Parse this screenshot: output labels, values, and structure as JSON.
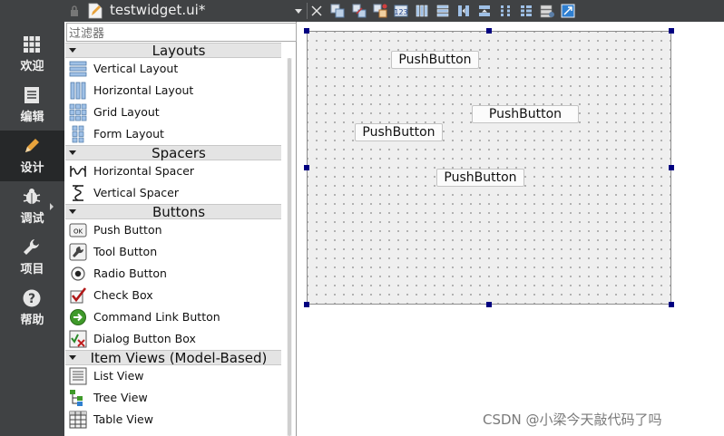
{
  "toolbar": {
    "document_title": "testwidget.ui*",
    "buttons": [
      "edit-widgets-icon",
      "edit-signals-icon",
      "edit-buddies-icon",
      "edit-tab-order-icon",
      "layout-horizontal-icon",
      "layout-vertical-icon",
      "layout-horizontal-splitter-icon",
      "layout-vertical-splitter-icon",
      "layout-grid-icon",
      "layout-form-icon",
      "break-layout-icon",
      "adjust-size-icon"
    ]
  },
  "modes": [
    {
      "label": "欢迎",
      "icon": "grid-icon"
    },
    {
      "label": "编辑",
      "icon": "document-icon"
    },
    {
      "label": "设计",
      "icon": "pencil-icon",
      "active": true
    },
    {
      "label": "调试",
      "icon": "bug-icon"
    },
    {
      "label": "项目",
      "icon": "wrench-icon"
    },
    {
      "label": "帮助",
      "icon": "help-icon"
    }
  ],
  "widget_box": {
    "filter_placeholder": "过滤器",
    "categories": [
      {
        "label": "Layouts",
        "items": [
          "Vertical Layout",
          "Horizontal Layout",
          "Grid Layout",
          "Form Layout"
        ]
      },
      {
        "label": "Spacers",
        "items": [
          "Horizontal Spacer",
          "Vertical Spacer"
        ]
      },
      {
        "label": "Buttons",
        "items": [
          "Push Button",
          "Tool Button",
          "Radio Button",
          "Check Box",
          "Command Link Button",
          "Dialog Button Box"
        ]
      },
      {
        "label": "Item Views (Model-Based)",
        "items": [
          "List View",
          "Tree View",
          "Table View"
        ]
      }
    ]
  },
  "form": {
    "buttons": [
      {
        "label": "PushButton"
      },
      {
        "label": "PushButton"
      },
      {
        "label": "PushButton"
      },
      {
        "label": "PushButton"
      }
    ]
  },
  "watermark": "CSDN @小梁今天敲代码了吗",
  "colors": {
    "modebar": "#404244",
    "active_mode": "#262829",
    "handle": "#000080",
    "form_bg": "#efefef"
  }
}
